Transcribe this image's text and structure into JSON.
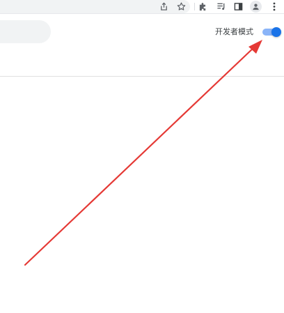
{
  "toolbar": {
    "icons": [
      "share-icon",
      "bookmark-star-icon",
      "extensions-icon",
      "reading-list-icon",
      "side-panel-icon",
      "profile-icon",
      "more-menu-icon"
    ]
  },
  "extensions_page": {
    "developer_mode_label": "开发者模式",
    "developer_mode_enabled": true
  },
  "colors": {
    "toggle_track": "#8ab4f8",
    "toggle_knob": "#1a73e8",
    "annotation_arrow": "#e53935"
  }
}
